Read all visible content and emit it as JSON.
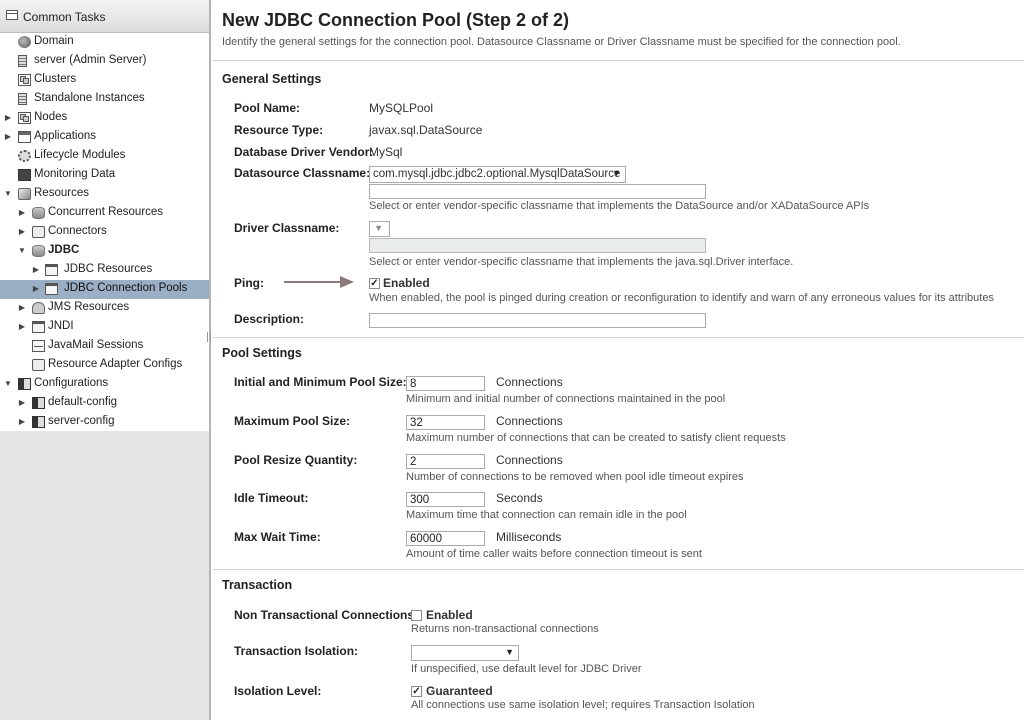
{
  "sidebar": {
    "header": "Common Tasks",
    "items": [
      {
        "label": "Domain"
      },
      {
        "label": "server (Admin Server)"
      },
      {
        "label": "Clusters"
      },
      {
        "label": "Standalone Instances"
      },
      {
        "label": "Nodes"
      },
      {
        "label": "Applications"
      },
      {
        "label": "Lifecycle Modules"
      },
      {
        "label": "Monitoring Data"
      },
      {
        "label": "Resources"
      },
      {
        "label": "Concurrent Resources"
      },
      {
        "label": "Connectors"
      },
      {
        "label": "JDBC"
      },
      {
        "label": "JDBC Resources"
      },
      {
        "label": "JDBC Connection Pools"
      },
      {
        "label": "JMS Resources"
      },
      {
        "label": "JNDI"
      },
      {
        "label": "JavaMail Sessions"
      },
      {
        "label": "Resource Adapter Configs"
      },
      {
        "label": "Configurations"
      },
      {
        "label": "default-config"
      },
      {
        "label": "server-config"
      }
    ]
  },
  "page": {
    "title": "New JDBC Connection Pool (Step 2 of 2)",
    "description": "Identify the general settings for the connection pool. Datasource Classname or Driver Classname must be specified for the connection pool."
  },
  "general": {
    "title": "General Settings",
    "pool_name_label": "Pool Name:",
    "pool_name_value": "MySQLPool",
    "resource_type_label": "Resource Type:",
    "resource_type_value": "javax.sql.DataSource",
    "vendor_label": "Database Driver Vendor:",
    "vendor_value": "MySql",
    "ds_label": "Datasource Classname:",
    "ds_selected": "com.mysql.jdbc.jdbc2.optional.MysqlDataSource",
    "ds_help": "Select or enter vendor-specific classname that implements the DataSource and/or XADataSource APIs",
    "driver_label": "Driver Classname:",
    "driver_help": "Select or enter vendor-specific classname that implements the java.sql.Driver interface.",
    "ping_label": "Ping:",
    "ping_enabled": true,
    "ping_check_label": "Enabled",
    "ping_help": "When enabled, the pool is pinged during creation or reconfiguration to identify and warn of any erroneous values for its attributes",
    "desc_label": "Description:"
  },
  "pool": {
    "title": "Pool Settings",
    "fields": [
      {
        "label": "Initial and Minimum Pool Size:",
        "value": "8",
        "unit": "Connections",
        "help": "Minimum and initial number of connections maintained in the pool"
      },
      {
        "label": "Maximum Pool Size:",
        "value": "32",
        "unit": "Connections",
        "help": "Maximum number of connections that can be created to satisfy client requests"
      },
      {
        "label": "Pool Resize Quantity:",
        "value": "2",
        "unit": "Connections",
        "help": "Number of connections to be removed when pool idle timeout expires"
      },
      {
        "label": "Idle Timeout:",
        "value": "300",
        "unit": "Seconds",
        "help": "Maximum time that connection can remain idle in the pool"
      },
      {
        "label": "Max Wait Time:",
        "value": "60000",
        "unit": "Milliseconds",
        "help": "Amount of time caller waits before connection timeout is sent"
      }
    ]
  },
  "transaction": {
    "title": "Transaction",
    "ntc_label": "Non Transactional Connections:",
    "ntc_checked": false,
    "ntc_check_label": "Enabled",
    "ntc_help": "Returns non-transactional connections",
    "isolation_label": "Transaction Isolation:",
    "isolation_help": "If unspecified, use default level for JDBC Driver",
    "level_label": "Isolation Level:",
    "level_checked": true,
    "level_check_label": "Guaranteed",
    "level_help": "All connections use same isolation level; requires Transaction Isolation"
  },
  "colors": {
    "selected_row": "#9aaec6",
    "arrow": "#8a7a7a"
  }
}
